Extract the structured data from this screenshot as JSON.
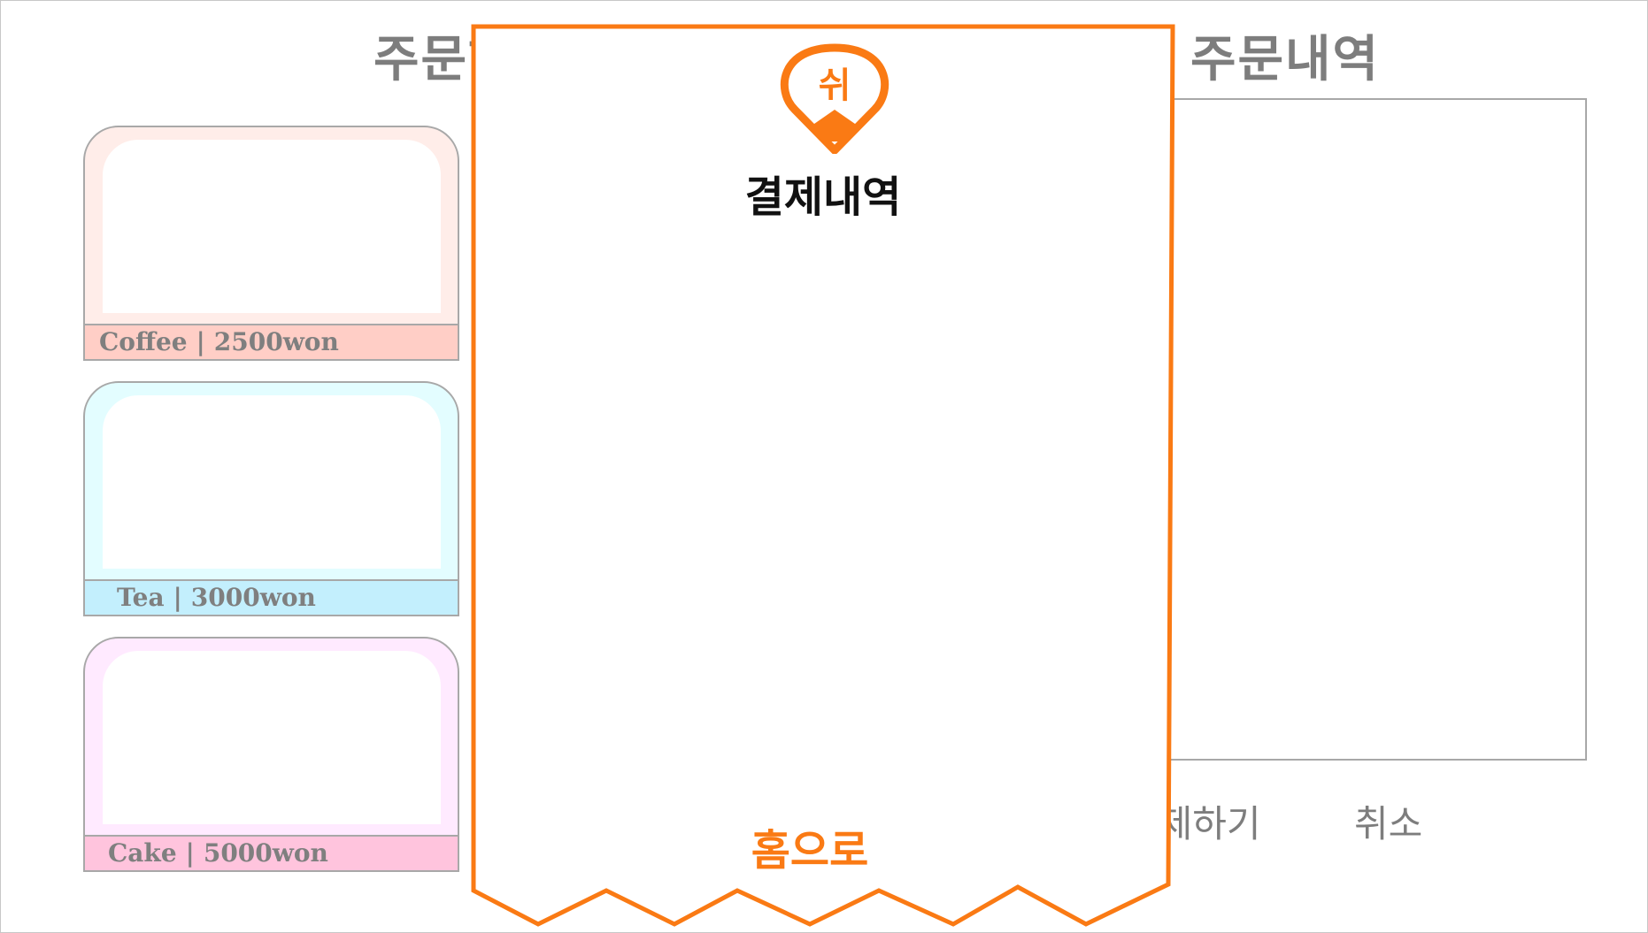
{
  "background": {
    "menu_heading": "주문하기",
    "order_heading": "주문내역",
    "menu_items": [
      {
        "name": "Coffee",
        "separator": "|",
        "price": "2500won",
        "bg_color": "#ffede9",
        "label_color": "#ffcec6"
      },
      {
        "name": "Tea",
        "separator": "|",
        "price": "3000won",
        "bg_color": "#e3fdff",
        "label_color": "#c3effd"
      },
      {
        "name": "Cake",
        "separator": "|",
        "price": "5000won",
        "bg_color": "#ffeaff",
        "label_color": "#ffc4dd"
      }
    ],
    "pay_label": "결제하기",
    "cancel_label": "취소"
  },
  "receipt": {
    "logo_text": "쉬",
    "title": "결제내역",
    "home_label": "홈으로",
    "accent_color": "#fa7a14"
  }
}
